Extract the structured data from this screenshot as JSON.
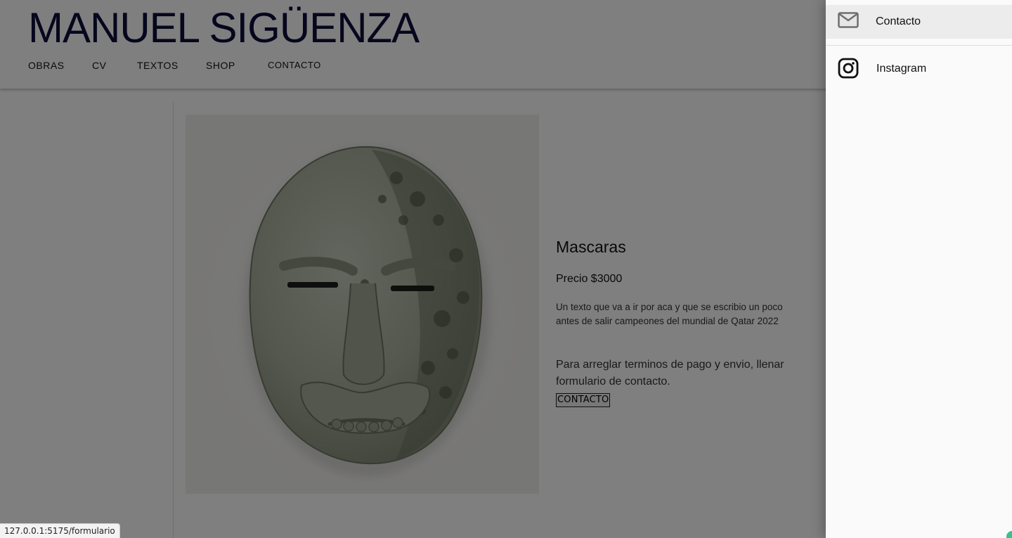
{
  "header": {
    "site_title": "MANUEL SIGÜENZA",
    "nav": [
      "OBRAS",
      "CV",
      "TEXTOS",
      "SHOP",
      "CONTACTO"
    ]
  },
  "product": {
    "title": "Mascaras",
    "price": "Precio $3000",
    "description": "Un texto que va a ir por aca y que se escribio un poco antes de salir campeones del mundial de Qatar 2022",
    "note": "Para arreglar terminos de pago y envio, llenar formulario de contacto.",
    "contact_button": "CONTACTO",
    "image_alt": "ceramic-mask-image"
  },
  "drawer": {
    "items": [
      {
        "label": "Contacto",
        "icon": "mail-icon",
        "active": true
      },
      {
        "label": "Instagram",
        "icon": "instagram-icon",
        "active": false
      }
    ]
  },
  "status_bar": {
    "url": "127.0.0.1:5175/formulario"
  },
  "colors": {
    "title": "#0d0d3a",
    "scrim": "rgba(0,0,0,0.5)",
    "drawer_bg": "#fafafa",
    "drawer_active": "#ececec",
    "icon_gray": "#6e6e6e"
  }
}
